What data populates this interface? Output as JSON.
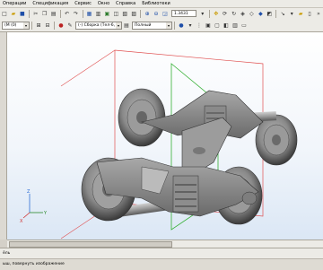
{
  "menu": {
    "items": [
      "Операции",
      "Спецификация",
      "Сервис",
      "Окно",
      "Справка",
      "Библиотеки"
    ]
  },
  "toolbar_top": {
    "zoom_value": "1.3431",
    "icons": [
      "zoom-in-icon",
      "zoom-out-icon",
      "zoom-window-icon",
      "pan-icon",
      "rotate-icon",
      "refresh-icon",
      "view-orient-icon",
      "wireframe-icon",
      "shaded-icon",
      "perspective-icon",
      "select-filter-icon",
      "section-icon",
      "measure-icon"
    ]
  },
  "toolbar_second": {
    "field_left": "(M (0)",
    "assembly_combo": "(-) Сборка (Тел-6, С",
    "display_combo": "Полный"
  },
  "colors": {
    "viewport_top": "#ffffff",
    "viewport_bottom": "#dbe7f5",
    "model_gray": "#8e8e8e",
    "bbox_red": "#e05050",
    "plane_green": "#35b035",
    "axis_blue": "#2f6fd6"
  },
  "triad": {
    "x_label": "X",
    "y_label": "Y",
    "z_label": "Z"
  },
  "status": {
    "main": "ёль",
    "hint": "ыш, повернуть изображение"
  }
}
